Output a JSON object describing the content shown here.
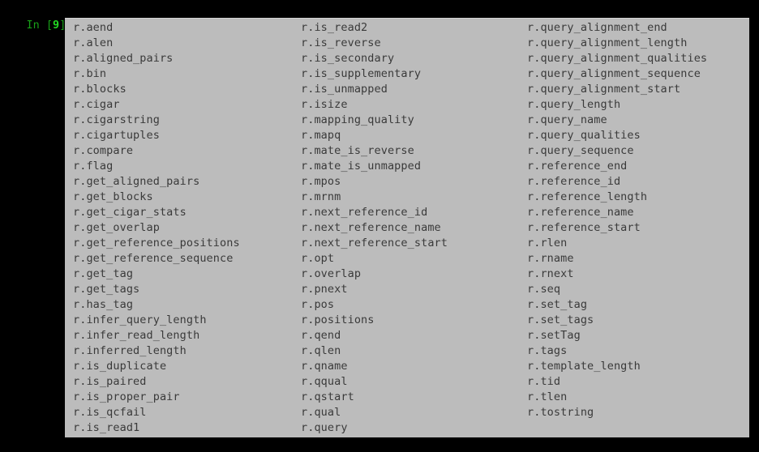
{
  "terminal": {
    "background_color": "#000000",
    "prompt": {
      "label_in": "In",
      "bracket_open": " [",
      "execution_count": "9",
      "bracket_close": "]",
      "colon": ": ",
      "input_text": "r.",
      "cursor": "block-cursor"
    }
  },
  "completion_popup": {
    "name": "tab-completion-dropdown",
    "background_color": "#bcbcbc",
    "text_color": "#3a3a3a",
    "border_color": "#d3d3d3",
    "columns": [
      {
        "index": 0,
        "items": [
          "r.aend",
          "r.alen",
          "r.aligned_pairs",
          "r.bin",
          "r.blocks",
          "r.cigar",
          "r.cigarstring",
          "r.cigartuples",
          "r.compare",
          "r.flag",
          "r.get_aligned_pairs",
          "r.get_blocks",
          "r.get_cigar_stats",
          "r.get_overlap",
          "r.get_reference_positions",
          "r.get_reference_sequence",
          "r.get_tag",
          "r.get_tags",
          "r.has_tag",
          "r.infer_query_length",
          "r.infer_read_length",
          "r.inferred_length",
          "r.is_duplicate",
          "r.is_paired",
          "r.is_proper_pair",
          "r.is_qcfail",
          "r.is_read1"
        ]
      },
      {
        "index": 1,
        "items": [
          "r.is_read2",
          "r.is_reverse",
          "r.is_secondary",
          "r.is_supplementary",
          "r.is_unmapped",
          "r.isize",
          "r.mapping_quality",
          "r.mapq",
          "r.mate_is_reverse",
          "r.mate_is_unmapped",
          "r.mpos",
          "r.mrnm",
          "r.next_reference_id",
          "r.next_reference_name",
          "r.next_reference_start",
          "r.opt",
          "r.overlap",
          "r.pnext",
          "r.pos",
          "r.positions",
          "r.qend",
          "r.qlen",
          "r.qname",
          "r.qqual",
          "r.qstart",
          "r.qual",
          "r.query"
        ]
      },
      {
        "index": 2,
        "items": [
          "r.query_alignment_end",
          "r.query_alignment_length",
          "r.query_alignment_qualities",
          "r.query_alignment_sequence",
          "r.query_alignment_start",
          "r.query_length",
          "r.query_name",
          "r.query_qualities",
          "r.query_sequence",
          "r.reference_end",
          "r.reference_id",
          "r.reference_length",
          "r.reference_name",
          "r.reference_start",
          "r.rlen",
          "r.rname",
          "r.rnext",
          "r.seq",
          "r.set_tag",
          "r.set_tags",
          "r.setTag",
          "r.tags",
          "r.template_length",
          "r.tid",
          "r.tlen",
          "r.tostring"
        ]
      }
    ]
  }
}
